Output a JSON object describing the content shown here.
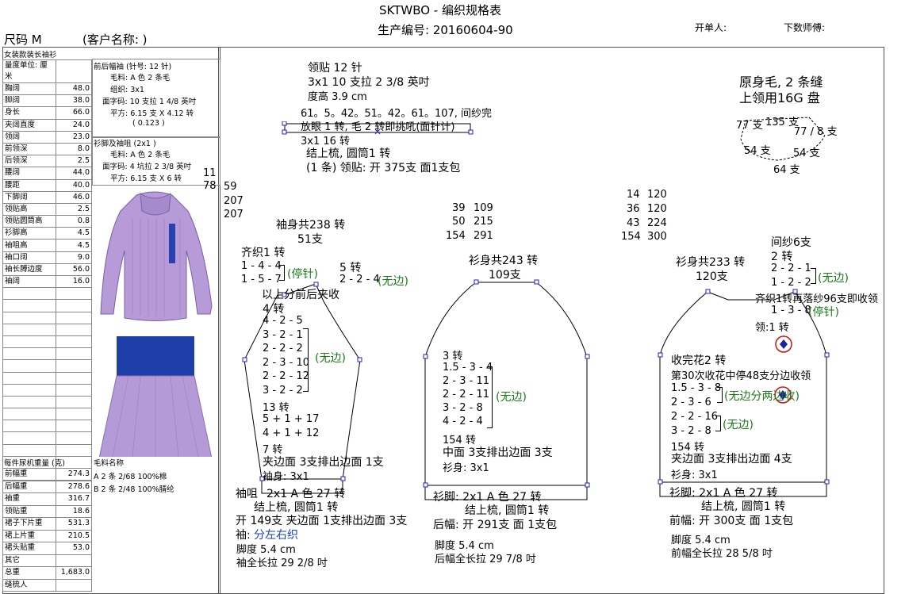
{
  "header": {
    "title": "SKTWBO - 编织规格表",
    "code": "生产编号: 20160604-90",
    "size": "尺码  M",
    "client": "(客户名称:                )",
    "issuer": "开单人:",
    "programmer": "下数师傅:"
  },
  "left": {
    "spec_title": "女装款装长袖衫",
    "spec_rows": [
      {
        "k": "量度单位: 厘米",
        "v": ""
      },
      {
        "k": "胸阔",
        "v": "48.0"
      },
      {
        "k": "脚阔",
        "v": "38.0"
      },
      {
        "k": "身长",
        "v": "66.0"
      },
      {
        "k": "夹阔直度",
        "v": "24.0"
      },
      {
        "k": "领阔",
        "v": "23.0"
      },
      {
        "k": "前领深",
        "v": "8.0"
      },
      {
        "k": "后领深",
        "v": "2.5"
      },
      {
        "k": "腰阔",
        "v": "44.0"
      },
      {
        "k": "腰距",
        "v": "40.0"
      },
      {
        "k": "下脚阔",
        "v": "46.0"
      },
      {
        "k": "领贴高",
        "v": "2.5"
      },
      {
        "k": "领贴圆筒高",
        "v": "0.8"
      },
      {
        "k": "衫脚高",
        "v": "4.5"
      },
      {
        "k": "袖咀高",
        "v": "4.5"
      },
      {
        "k": "袖口阔",
        "v": "9.0"
      },
      {
        "k": "袖长膊边度",
        "v": "56.0"
      },
      {
        "k": "袖阔",
        "v": "16.0"
      },
      {
        "k": "",
        "v": ""
      },
      {
        "k": "",
        "v": ""
      },
      {
        "k": "",
        "v": ""
      },
      {
        "k": "",
        "v": ""
      },
      {
        "k": "",
        "v": ""
      },
      {
        "k": "",
        "v": ""
      },
      {
        "k": "",
        "v": ""
      },
      {
        "k": "",
        "v": ""
      },
      {
        "k": "",
        "v": ""
      },
      {
        "k": "",
        "v": ""
      },
      {
        "k": "",
        "v": ""
      },
      {
        "k": "",
        "v": ""
      },
      {
        "k": "",
        "v": ""
      },
      {
        "k": "",
        "v": ""
      },
      {
        "k": "",
        "v": ""
      },
      {
        "k": "",
        "v": ""
      }
    ],
    "body_note": {
      "title": "前后幅袖 (针号: 12 针)",
      "l1": "毛料: A 色 2 条毛",
      "l2": "组织: 3x1",
      "l3": "面字码: 10 支拉 1 4/8 英吋",
      "l4": "平方: 6.15 支 X  4.12 转",
      "l5": "( 0.123 )"
    },
    "rib_note": {
      "title": "衫脚及袖咀 (2x1 )",
      "l1": "毛料: A 色 2 条毛",
      "l2": "面字码: 4 坑拉 2 3/8 英吋",
      "l3": "平方: 6.15 支 X  6 转"
    },
    "weight_title": "每件尿机重量 (克)",
    "yarn_title": "毛料名称",
    "yarn_a": "A  2 条 2/68 100%棉",
    "yarn_b": "B   2 条 2/48 100%腈纶",
    "weights": [
      {
        "k": "前幅重",
        "v": "274.3"
      },
      {
        "k": "后幅重",
        "v": "278.6"
      },
      {
        "k": "袖重",
        "v": "316.7"
      },
      {
        "k": "领贴重",
        "v": "18.6"
      },
      {
        "k": "裙子下片重",
        "v": "531.3"
      },
      {
        "k": "裙上片重",
        "v": "210.5"
      },
      {
        "k": "裙头贴重",
        "v": "53.0"
      },
      {
        "k": "其它",
        "v": ""
      },
      {
        "k": "总重",
        "v": "1,683.0"
      },
      {
        "k": "缝梳人",
        "v": ""
      }
    ]
  },
  "collar": {
    "l1": "领贴  12 针",
    "l2": "3x1   10 支拉 2 3/8 英吋",
    "l3": "度高 3.9 cm",
    "l4": "61。5。42。51。42。61。107, 间纱完",
    "l5": "放眼 1 转, 毛 2 转即挑吼(面针计)",
    "l6": "3x1          16 转",
    "l7": "结上梳, 圆筒1 转",
    "l8": "(1 条) 领贴: 开 375支 面1支包"
  },
  "note_right": {
    "l1": "原身毛, 2 条缝",
    "l2": "上领用16G 盘"
  },
  "neck_diag": {
    "a": "77 支",
    "b": "135 支",
    "c": "77 / 8 支",
    "d": "54 支",
    "e": "54 支",
    "f": "64 支"
  },
  "misc": {
    "n11": "11",
    "n78": "78",
    "n59": "59",
    "n207a": "207",
    "n207b": "207"
  },
  "mid_nums": {
    "a1": "39",
    "a2": "109",
    "b1": "50",
    "b2": "215",
    "c1": "154",
    "c2": "291"
  },
  "right_nums": {
    "a1": "14",
    "a2": "120",
    "b1": "36",
    "b2": "120",
    "c1": "43",
    "c2": "224",
    "d1": "154",
    "d2": "300"
  },
  "sleeve": {
    "total": "袖身共238 转",
    "width": "51支",
    "top1": "齐织1 转",
    "r1": "1 - 4 - 4",
    "r2": "1 - 5 - 7",
    "tag1": "(停针)",
    "r3": "5 转",
    "r4": "2 - 2 - 4",
    "tag2": "(无边)",
    "note1": "以上分前后夹收",
    "t1": "4 转",
    "rows": [
      "4 - 2 - 5",
      "3 - 2 - 1",
      "2 - 2 - 2",
      "2 - 3 - 10",
      "2 - 2 - 12",
      "3 - 2 - 2"
    ],
    "tag3": "(无边)",
    "r13": "13 转",
    "r14": "5 + 1 + 17",
    "r15": "4 + 1 + 12",
    "r16": "7 转",
    "edge": "夹边面 3支排出边面 1支",
    "stitch": "袖身: 3x1",
    "cuff_lbl": "袖咀",
    "cuff": "2x1      A 色 27 转",
    "join": "结上梳, 圆筒1 转",
    "open": "开 149支 夹边面 1支排出边面 3支",
    "split_lbl": "袖:",
    "split": "分左右织",
    "gauge": "脚度 5.4 cm",
    "len": "袖全长拉 29 2/8 吋"
  },
  "back": {
    "total": "衫身共243 转",
    "width": "109支",
    "t1": "3 转",
    "rows": [
      "1.5 - 3 - 4",
      "2 - 3 - 11",
      "2 - 2 - 11",
      "3 - 2 - 8",
      "4 - 2 - 4"
    ],
    "tag": "(无边)",
    "r154": "154 转",
    "edge": "中面 3支排出边面 3支",
    "stitch": "衫身: 3x1",
    "hem": "衫脚: 2x1      A 色 27 转",
    "join": "结上梳, 圆筒1 转",
    "open": "后幅: 开 291支 面 1支包",
    "gauge": "脚度 5.4 cm",
    "len": "后幅全长拉 29 7/8 吋"
  },
  "front": {
    "total": "衫身共233 转",
    "width": "120支",
    "w1": "间纱6支",
    "w2": "2 转",
    "w3": "2 - 2 - 1",
    "w4": "1 - 2 - 2",
    "tag1": "(无边)",
    "w5": "齐织1转再落纱96支即收领",
    "w6": "1 - 3 - 8",
    "tag2": "(停针)",
    "w7": "领:1 转",
    "f1": "收完花2 转",
    "f2": "第30次收花中停48支分边收领",
    "rows": [
      "1.5 - 3 - 8",
      "2 - 3 - 6"
    ],
    "tag3": "(无边分两边收)",
    "rows2": [
      "2 - 2 - 16",
      "3 - 2 - 8"
    ],
    "tag4": "(无边)",
    "r154": "154 转",
    "edge": "夹边面 3支排出边面 4支",
    "stitch": "衫身: 3x1",
    "hem": "衫脚: 2x1      A 色 27 转",
    "join": "结上梳, 圆筒1 转",
    "open": "前幅: 开 300支 面 1支包",
    "gauge": "脚度 5.4 cm",
    "len": "前幅全长拉 28 5/8 吋"
  },
  "colors": {
    "sweater": "#b79ad8",
    "skirt_top": "#1e3fa8",
    "skirt": "#b49ad6",
    "node": "#2020c0",
    "accent_red": "#d01010"
  }
}
